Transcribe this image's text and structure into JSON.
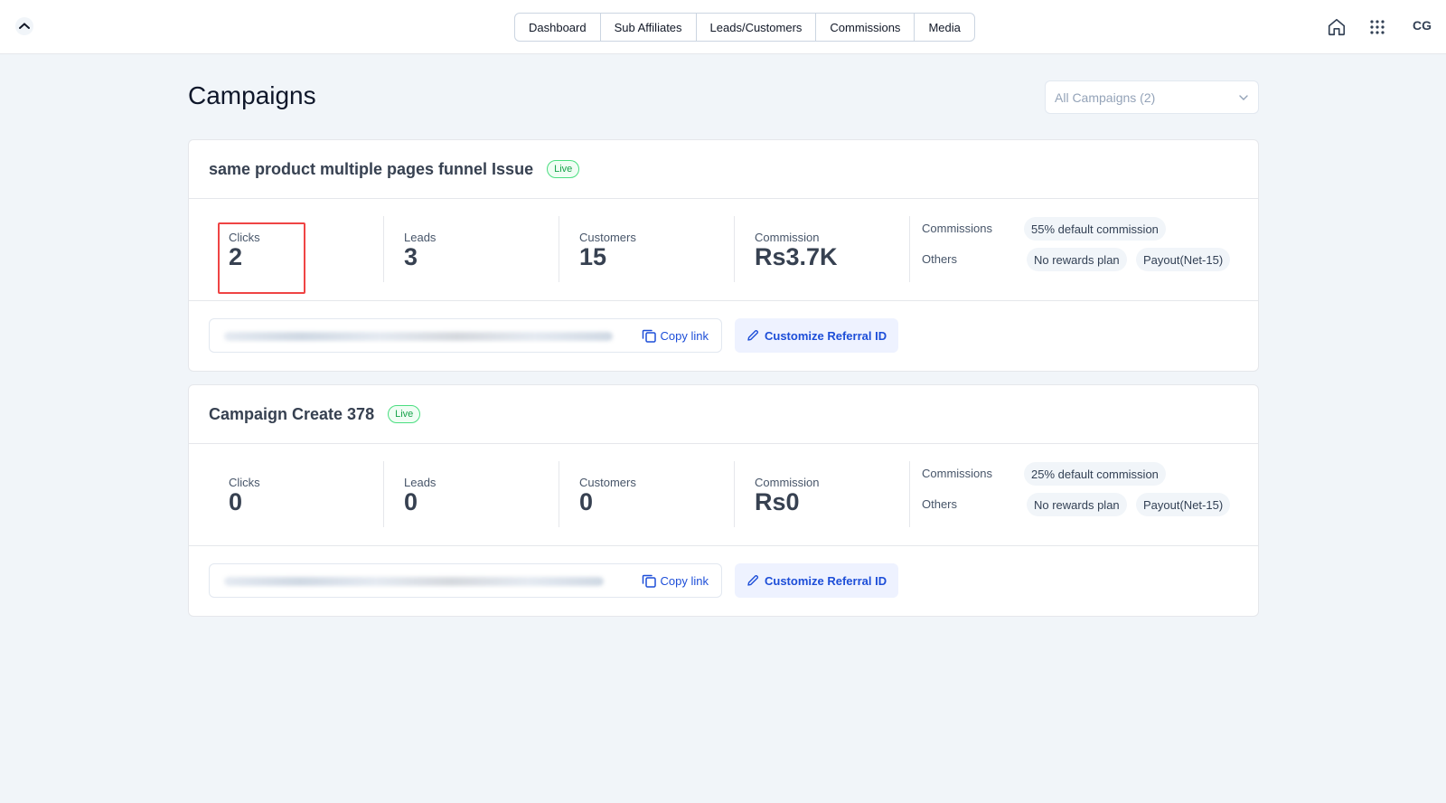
{
  "nav": {
    "items": [
      "Dashboard",
      "Sub Affiliates",
      "Leads/Customers",
      "Commissions",
      "Media"
    ],
    "avatar": "CG"
  },
  "page": {
    "title": "Campaigns",
    "filter": "All Campaigns (2)"
  },
  "campaigns": [
    {
      "name": "same product multiple pages funnel Issue",
      "status": "Live",
      "stats": [
        {
          "label": "Clicks",
          "value": "2"
        },
        {
          "label": "Leads",
          "value": "3"
        },
        {
          "label": "Customers",
          "value": "15"
        },
        {
          "label": "Commission",
          "value": "Rs3.7K"
        }
      ],
      "commissions_label": "Commissions",
      "commission_plan": "55% default commission",
      "others_label": "Others",
      "others": [
        "No rewards plan",
        "Payout(Net-15)"
      ],
      "copy_label": "Copy link",
      "customize_label": "Customize Referral ID"
    },
    {
      "name": "Campaign Create 378",
      "status": "Live",
      "stats": [
        {
          "label": "Clicks",
          "value": "0"
        },
        {
          "label": "Leads",
          "value": "0"
        },
        {
          "label": "Customers",
          "value": "0"
        },
        {
          "label": "Commission",
          "value": "Rs0"
        }
      ],
      "commissions_label": "Commissions",
      "commission_plan": "25% default commission",
      "others_label": "Others",
      "others": [
        "No rewards plan",
        "Payout(Net-15)"
      ],
      "copy_label": "Copy link",
      "customize_label": "Customize Referral ID"
    }
  ],
  "colors": {
    "accent": "#1d4ed8",
    "live": "#16a34a",
    "highlight": "#ef4444",
    "background": "#f1f5f9"
  }
}
